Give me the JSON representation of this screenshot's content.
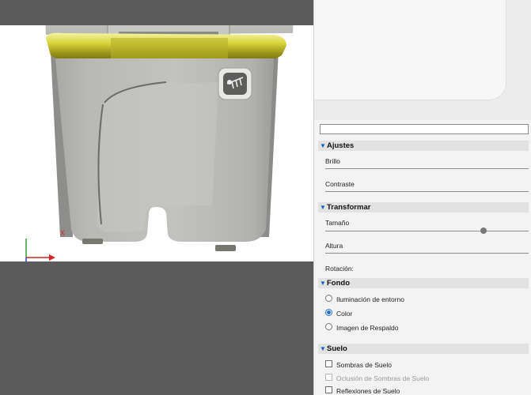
{
  "viewport": {
    "axes": {
      "x_label": "X",
      "icon": "axis-gizmo-icon"
    },
    "model_badge_icon": "fishbone-icon"
  },
  "panel": {
    "search": {
      "value": "",
      "placeholder": ""
    },
    "sections": {
      "ajustes": {
        "title": "Ajustes",
        "brillo": "Brillo",
        "contraste": "Contraste"
      },
      "transformar": {
        "title": "Transformar",
        "tamano": "Tamaño",
        "altura": "Altura",
        "rotacion": "Rotación:"
      },
      "fondo": {
        "title": "Fondo",
        "options": [
          "Iluminación de entorno",
          "Color",
          "Imagen de Respaldo"
        ],
        "selected": "Color"
      },
      "suelo": {
        "title": "Suelo",
        "options": [
          "Sombras de Suelo",
          "Oclusión de Sombras de Suelo",
          "Reflexiones de Suelo"
        ]
      }
    },
    "colors": {
      "accent": "#2773d1",
      "header_bg": "#e2e2e2",
      "panel_bg": "#f3f3f3"
    }
  }
}
